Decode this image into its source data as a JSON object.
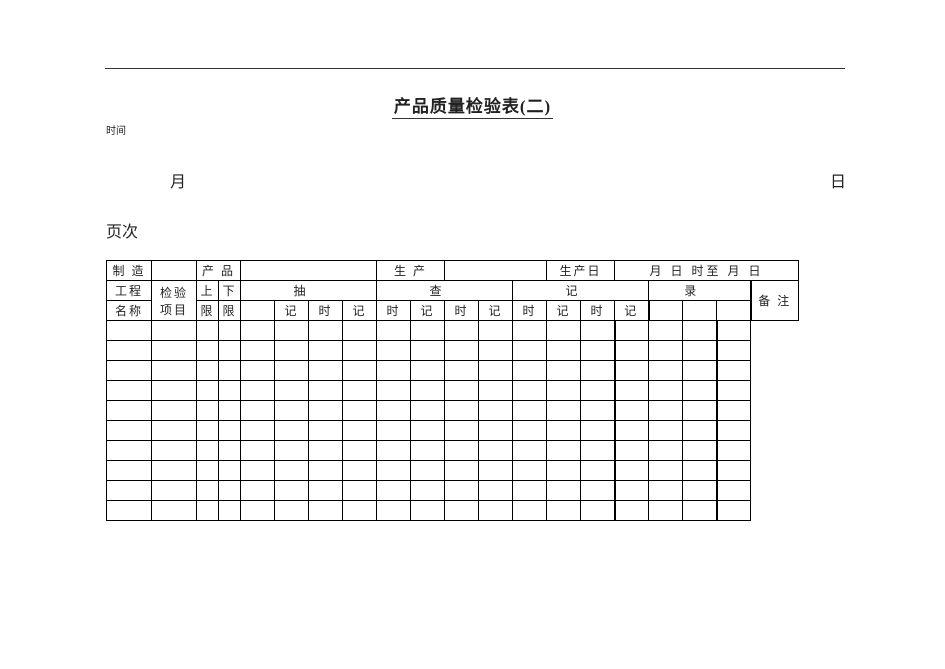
{
  "doc": {
    "title": "产品质量检验表(二)",
    "time_label": "时间",
    "month_label": "月",
    "day_label": "日",
    "page_label": "页次"
  },
  "row1": {
    "c_manu": "制 造",
    "c_prod": "产 品",
    "c_shengchan": "生 产",
    "c_shengchanri": "生产日",
    "c_datetime": "月 日 时至 月  日"
  },
  "row2": {
    "c_gongcheng": "工程",
    "c_jianyan": "检验",
    "c_shang": "上",
    "c_xia": "下",
    "c_chou": "抽",
    "c_cha": "查",
    "c_ji": "记",
    "c_lu": "录",
    "c_beizhu": "备 注"
  },
  "row3": {
    "c_mingcheng": "名称",
    "c_xiangmu": "项目",
    "c_xian1": "限",
    "c_xian2": "限",
    "s1_ji": "记",
    "s1_shi": "时",
    "s2_ji": "记",
    "s2_shi": "时",
    "s3_ji": "记",
    "s3_shi": "时",
    "s4_ji": "记",
    "s4_shi": "时",
    "s5_ji": "记",
    "s5_shi": "时",
    "s6_ji": "记"
  }
}
